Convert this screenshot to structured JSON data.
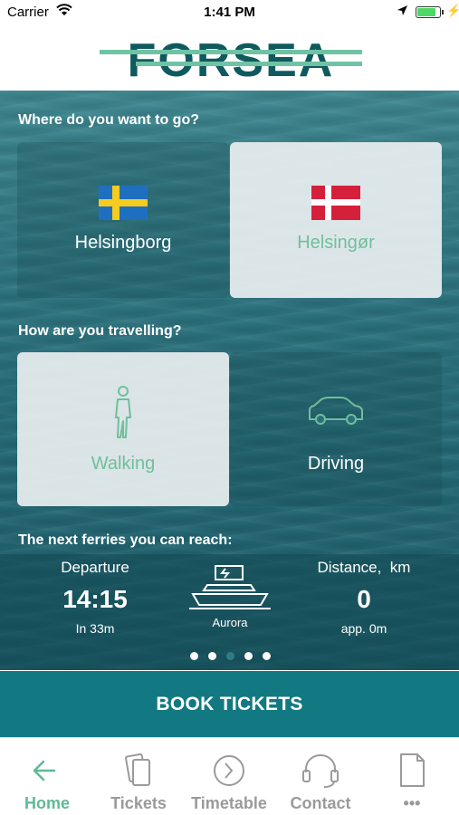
{
  "status_bar": {
    "carrier": "Carrier",
    "time": "1:41 PM",
    "battery_level": 0.85
  },
  "header": {
    "logo_text": "FORSEA"
  },
  "destination": {
    "heading": "Where do you want to go?",
    "options": [
      {
        "label": "Helsingborg",
        "flag": "sweden-flag",
        "selected": false
      },
      {
        "label": "Helsingør",
        "flag": "denmark-flag",
        "selected": true
      }
    ]
  },
  "travel_mode": {
    "heading": "How are you travelling?",
    "options": [
      {
        "label": "Walking",
        "icon": "walking-person-icon",
        "selected": true
      },
      {
        "label": "Driving",
        "icon": "car-icon",
        "selected": false
      }
    ]
  },
  "ferries": {
    "heading": "The next ferries you can reach:",
    "departure_label": "Departure",
    "departure_time": "14:15",
    "departure_in": "In 33m",
    "ferry_name": "Aurora",
    "ferry_icon": "ferry-icon",
    "distance_label": "Distance,  km",
    "distance_value": "0",
    "distance_sub": "app. 0m",
    "page_count": 5,
    "active_page": 2
  },
  "book_button": {
    "label": "BOOK TICKETS"
  },
  "tabs": [
    {
      "label": "Home",
      "icon": "arrow-left-icon",
      "active": true
    },
    {
      "label": "Tickets",
      "icon": "tickets-icon",
      "active": false
    },
    {
      "label": "Timetable",
      "icon": "clock-icon",
      "active": false
    },
    {
      "label": "Contact",
      "icon": "headset-icon",
      "active": false
    },
    {
      "label": "•••",
      "icon": "document-icon",
      "active": false
    }
  ],
  "colors": {
    "accent": "#5fb997",
    "book_button": "#127982",
    "tab_inactive": "#9a9a9a"
  }
}
